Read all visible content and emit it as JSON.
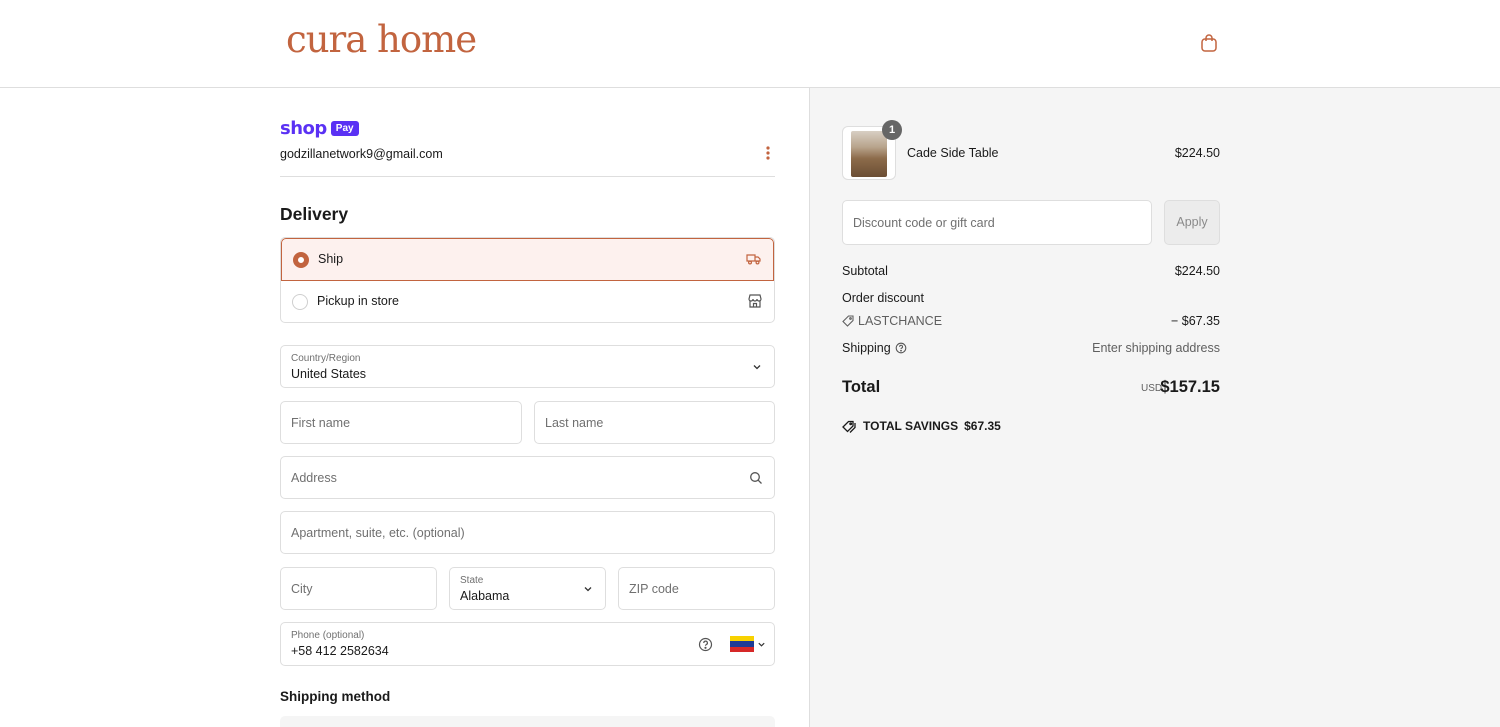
{
  "brand": {
    "logo_text": "cura home",
    "accent": "#c2643f"
  },
  "header": {
    "cart_icon": "shopping-bag-icon"
  },
  "shop_pay": {
    "shop_text": "shop",
    "pay_text": "Pay",
    "email": "godzillanetwork9@gmail.com",
    "color": "#5a31f4"
  },
  "delivery": {
    "title": "Delivery",
    "options": [
      {
        "label": "Ship",
        "selected": true,
        "icon": "truck-icon"
      },
      {
        "label": "Pickup in store",
        "selected": false,
        "icon": "store-icon"
      }
    ]
  },
  "form": {
    "country": {
      "label": "Country/Region",
      "value": "United States"
    },
    "first_name": {
      "placeholder": "First name"
    },
    "last_name": {
      "placeholder": "Last name"
    },
    "address": {
      "placeholder": "Address"
    },
    "apartment": {
      "placeholder": "Apartment, suite, etc. (optional)"
    },
    "city": {
      "placeholder": "City"
    },
    "state": {
      "label": "State",
      "value": "Alabama"
    },
    "zip": {
      "placeholder": "ZIP code"
    },
    "phone": {
      "label": "Phone (optional)",
      "value": "+58 412 2582634"
    }
  },
  "shipping_method": {
    "title": "Shipping method"
  },
  "order": {
    "item": {
      "name": "Cade Side Table",
      "price": "$224.50",
      "quantity": "1"
    },
    "discount": {
      "placeholder": "Discount code or gift card",
      "apply_label": "Apply"
    },
    "subtotal": {
      "label": "Subtotal",
      "value": "$224.50"
    },
    "order_discount": {
      "label": "Order discount",
      "code": "LASTCHANCE",
      "value": "− $67.35"
    },
    "shipping": {
      "label": "Shipping",
      "value": "Enter shipping address"
    },
    "total": {
      "label": "Total",
      "currency": "USD",
      "value": "$157.15"
    },
    "savings": {
      "label": "TOTAL SAVINGS",
      "value": "$67.35"
    }
  }
}
